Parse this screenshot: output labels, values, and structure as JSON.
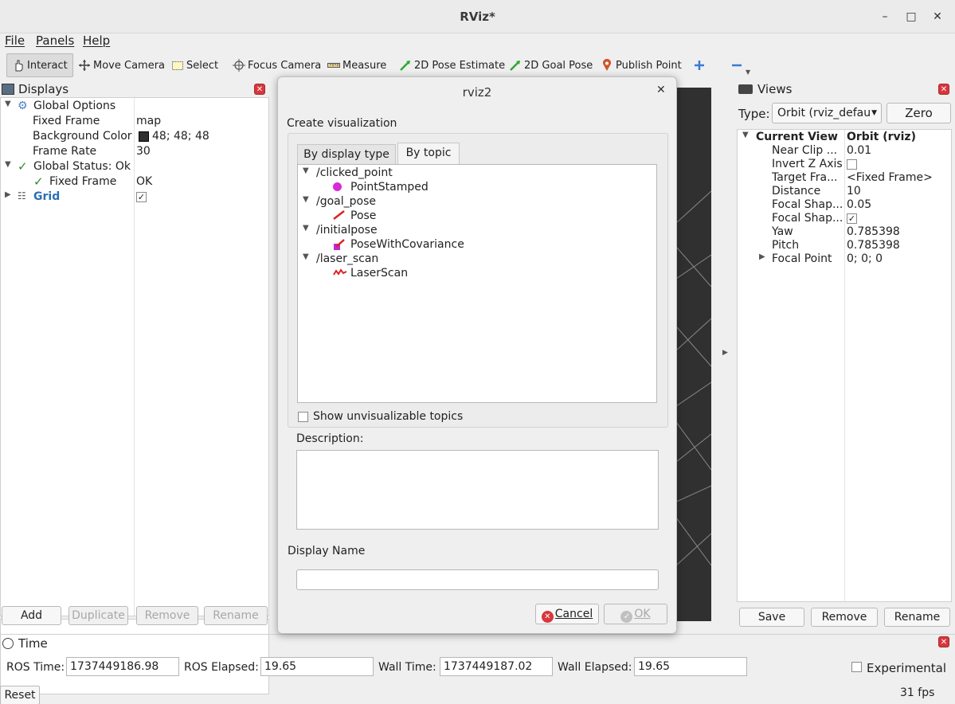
{
  "window": {
    "title": "RViz*"
  },
  "menu": [
    "File",
    "Panels",
    "Help"
  ],
  "toolbar": {
    "interact": "Interact",
    "move_camera": "Move Camera",
    "select": "Select",
    "focus_camera": "Focus Camera",
    "measure": "Measure",
    "pose_estimate": "2D Pose Estimate",
    "goal_pose": "2D Goal Pose",
    "publish_point": "Publish Point"
  },
  "displays": {
    "title": "Displays",
    "global_options": "Global Options",
    "fixed_frame_label": "Fixed Frame",
    "fixed_frame_value": "map",
    "bg_color_label": "Background Color",
    "bg_color_value": "48; 48; 48",
    "frame_rate_label": "Frame Rate",
    "frame_rate_value": "30",
    "global_status": "Global Status: Ok",
    "status_fixed_frame": "Fixed Frame",
    "status_fixed_frame_value": "OK",
    "grid": "Grid",
    "buttons": {
      "add": "Add",
      "duplicate": "Duplicate",
      "remove": "Remove",
      "rename": "Rename"
    }
  },
  "dialog": {
    "title": "rviz2",
    "create_label": "Create visualization",
    "tab_display_type": "By display type",
    "tab_topic": "By topic",
    "topics": [
      {
        "topic": "/clicked_point",
        "type": "PointStamped"
      },
      {
        "topic": "/goal_pose",
        "type": "Pose"
      },
      {
        "topic": "/initialpose",
        "type": "PoseWithCovariance"
      },
      {
        "topic": "/laser_scan",
        "type": "LaserScan"
      }
    ],
    "show_unvisualizable": "Show unvisualizable topics",
    "description_label": "Description:",
    "display_name_label": "Display Name",
    "cancel": "Cancel",
    "ok": "OK"
  },
  "views": {
    "title": "Views",
    "type_label": "Type:",
    "type_value": "Orbit (rviz_defau",
    "zero": "Zero",
    "current_view": "Current View",
    "current_view_value": "Orbit (rviz)",
    "props": [
      {
        "k": "Near Clip ...",
        "v": "0.01"
      },
      {
        "k": "Invert Z Axis",
        "v": ""
      },
      {
        "k": "Target Fra...",
        "v": "<Fixed Frame>"
      },
      {
        "k": "Distance",
        "v": "10"
      },
      {
        "k": "Focal Shap...",
        "v": "0.05"
      },
      {
        "k": "Focal Shap...",
        "v": ""
      },
      {
        "k": "Yaw",
        "v": "0.785398"
      },
      {
        "k": "Pitch",
        "v": "0.785398"
      },
      {
        "k": "Focal Point",
        "v": "0; 0; 0"
      }
    ],
    "buttons": {
      "save": "Save",
      "remove": "Remove",
      "rename": "Rename"
    }
  },
  "time": {
    "title": "Time",
    "ros_time_label": "ROS Time:",
    "ros_time": "1737449186.98",
    "ros_elapsed_label": "ROS Elapsed:",
    "ros_elapsed": "19.65",
    "wall_time_label": "Wall Time:",
    "wall_time": "1737449187.02",
    "wall_elapsed_label": "Wall Elapsed:",
    "wall_elapsed": "19.65",
    "experimental": "Experimental",
    "reset": "Reset",
    "fps": "31 fps"
  },
  "colors": {
    "bg": "#303030",
    "accent": "#2a6fb5",
    "close": "#d9363e"
  }
}
